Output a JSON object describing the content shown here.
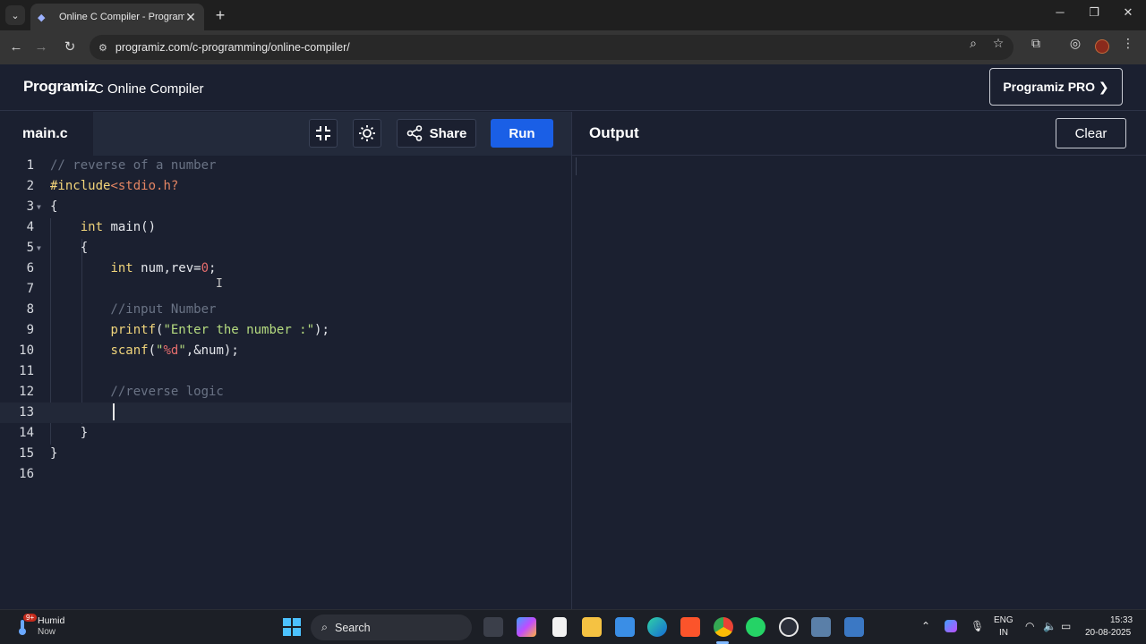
{
  "browser": {
    "tab_title": "Online C Compiler - Programiz",
    "url": "programiz.com/c-programming/online-compiler/"
  },
  "site": {
    "logo_text": "Programiz",
    "page_title": "C Online Compiler",
    "pro_button": "Programiz PRO ❯"
  },
  "toolbar": {
    "file_name": "main.c",
    "share_label": "Share",
    "run_label": "Run",
    "output_label": "Output",
    "clear_label": "Clear"
  },
  "editor": {
    "active_line": 13,
    "lines": [
      {
        "n": "1",
        "text": "// reverse of a number"
      },
      {
        "n": "2",
        "text": "#include<stdio.h?"
      },
      {
        "n": "3",
        "text": "{"
      },
      {
        "n": "4",
        "text": "    int main()"
      },
      {
        "n": "5",
        "text": "    {"
      },
      {
        "n": "6",
        "text": "        int num,rev=0;"
      },
      {
        "n": "7",
        "text": ""
      },
      {
        "n": "8",
        "text": "        //input Number"
      },
      {
        "n": "9",
        "text": "        printf(\"Enter the number :\");"
      },
      {
        "n": "10",
        "text": "        scanf(\"%d\",&num);"
      },
      {
        "n": "11",
        "text": ""
      },
      {
        "n": "12",
        "text": "        //reverse logic"
      },
      {
        "n": "13",
        "text": "        "
      },
      {
        "n": "14",
        "text": "    }"
      },
      {
        "n": "15",
        "text": "}"
      },
      {
        "n": "16",
        "text": ""
      }
    ]
  },
  "taskbar": {
    "weather_title": "Humid",
    "weather_sub": "Now",
    "weather_badge": "9+",
    "search_label": "Search",
    "lang_top": "ENG",
    "lang_bottom": "IN",
    "time": "15:33",
    "date": "20-08-2025"
  }
}
